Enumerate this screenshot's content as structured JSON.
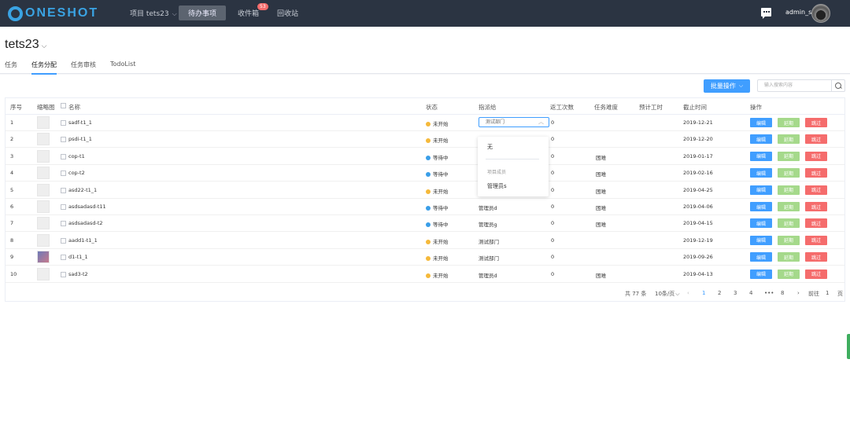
{
  "brand": {
    "name": "ONESHOT",
    "accent": "#3aa3e3"
  },
  "topnav": {
    "project": "项目 tets23",
    "todo": "待办事项",
    "inbox": "收件箱",
    "inbox_badge": "53",
    "recycle": "回收站",
    "user": "admin_s"
  },
  "page": {
    "title": "tets23",
    "tabs": [
      "任务",
      "任务分配",
      "任务审核",
      "TodoList"
    ]
  },
  "toolbar": {
    "batch_label": "批量操作",
    "search_placeholder": "输入搜索内容"
  },
  "table": {
    "headers": {
      "index": "序号",
      "thumb": "缩略图",
      "name": "名称",
      "status": "状态",
      "assignee": "指派给",
      "returns": "返工次数",
      "difficulty": "任务难度",
      "est_hours": "预计工时",
      "deadline": "截止时间",
      "ops": "操作"
    },
    "rows": [
      {
        "index": "1",
        "name": "sadf-t1_1",
        "status": "未开始",
        "status_color": "#f5b93a",
        "assignee": "测试部门",
        "returns": "0",
        "difficulty": "",
        "deadline": "2019-12-21"
      },
      {
        "index": "2",
        "name": "psdi-t1_1",
        "status": "未开始",
        "status_color": "#f5b93a",
        "assignee": "",
        "returns": "0",
        "difficulty": "",
        "deadline": "2019-12-20"
      },
      {
        "index": "3",
        "name": "cop-t1",
        "status": "等待中",
        "status_color": "#3a9ee8",
        "assignee": "",
        "returns": "0",
        "difficulty": "困难",
        "deadline": "2019-01-17"
      },
      {
        "index": "4",
        "name": "cop-t2",
        "status": "等待中",
        "status_color": "#3a9ee8",
        "assignee": "",
        "returns": "0",
        "difficulty": "困难",
        "deadline": "2019-02-16"
      },
      {
        "index": "5",
        "name": "asd22-t1_1",
        "status": "未开始",
        "status_color": "#f5b93a",
        "assignee": "",
        "returns": "0",
        "difficulty": "困难",
        "deadline": "2019-04-25"
      },
      {
        "index": "6",
        "name": "asdsadasd-t11",
        "status": "等待中",
        "status_color": "#3a9ee8",
        "assignee": "管理员d",
        "returns": "0",
        "difficulty": "困难",
        "deadline": "2019-04-06"
      },
      {
        "index": "7",
        "name": "asdsadasd-t2",
        "status": "等待中",
        "status_color": "#3a9ee8",
        "assignee": "管理员g",
        "returns": "0",
        "difficulty": "困难",
        "deadline": "2019-04-15"
      },
      {
        "index": "8",
        "name": "aadd1-t1_1",
        "status": "未开始",
        "status_color": "#f5b93a",
        "assignee": "测试部门",
        "returns": "0",
        "difficulty": "",
        "deadline": "2019-12-19"
      },
      {
        "index": "9",
        "name": "d1-t1_1",
        "status": "未开始",
        "status_color": "#f5b93a",
        "assignee": "测试部门",
        "returns": "0",
        "difficulty": "",
        "deadline": "2019-09-26"
      },
      {
        "index": "10",
        "name": "sad3-t2",
        "status": "未开始",
        "status_color": "#f5b93a",
        "assignee": "管理员d",
        "returns": "0",
        "difficulty": "困难",
        "deadline": "2019-04-13"
      }
    ],
    "btn_edit": "编辑",
    "btn_extend": "延期",
    "btn_skip": "跳过"
  },
  "dropdown": {
    "none": "无",
    "group": "项目成员",
    "option": "管理员s"
  },
  "pager": {
    "total": "共 77 条",
    "page_size": "10条/页",
    "pages": [
      "1",
      "2",
      "3",
      "4",
      "•••",
      "8"
    ],
    "goto": "前往",
    "goto_value": "1",
    "page_word": "页"
  }
}
